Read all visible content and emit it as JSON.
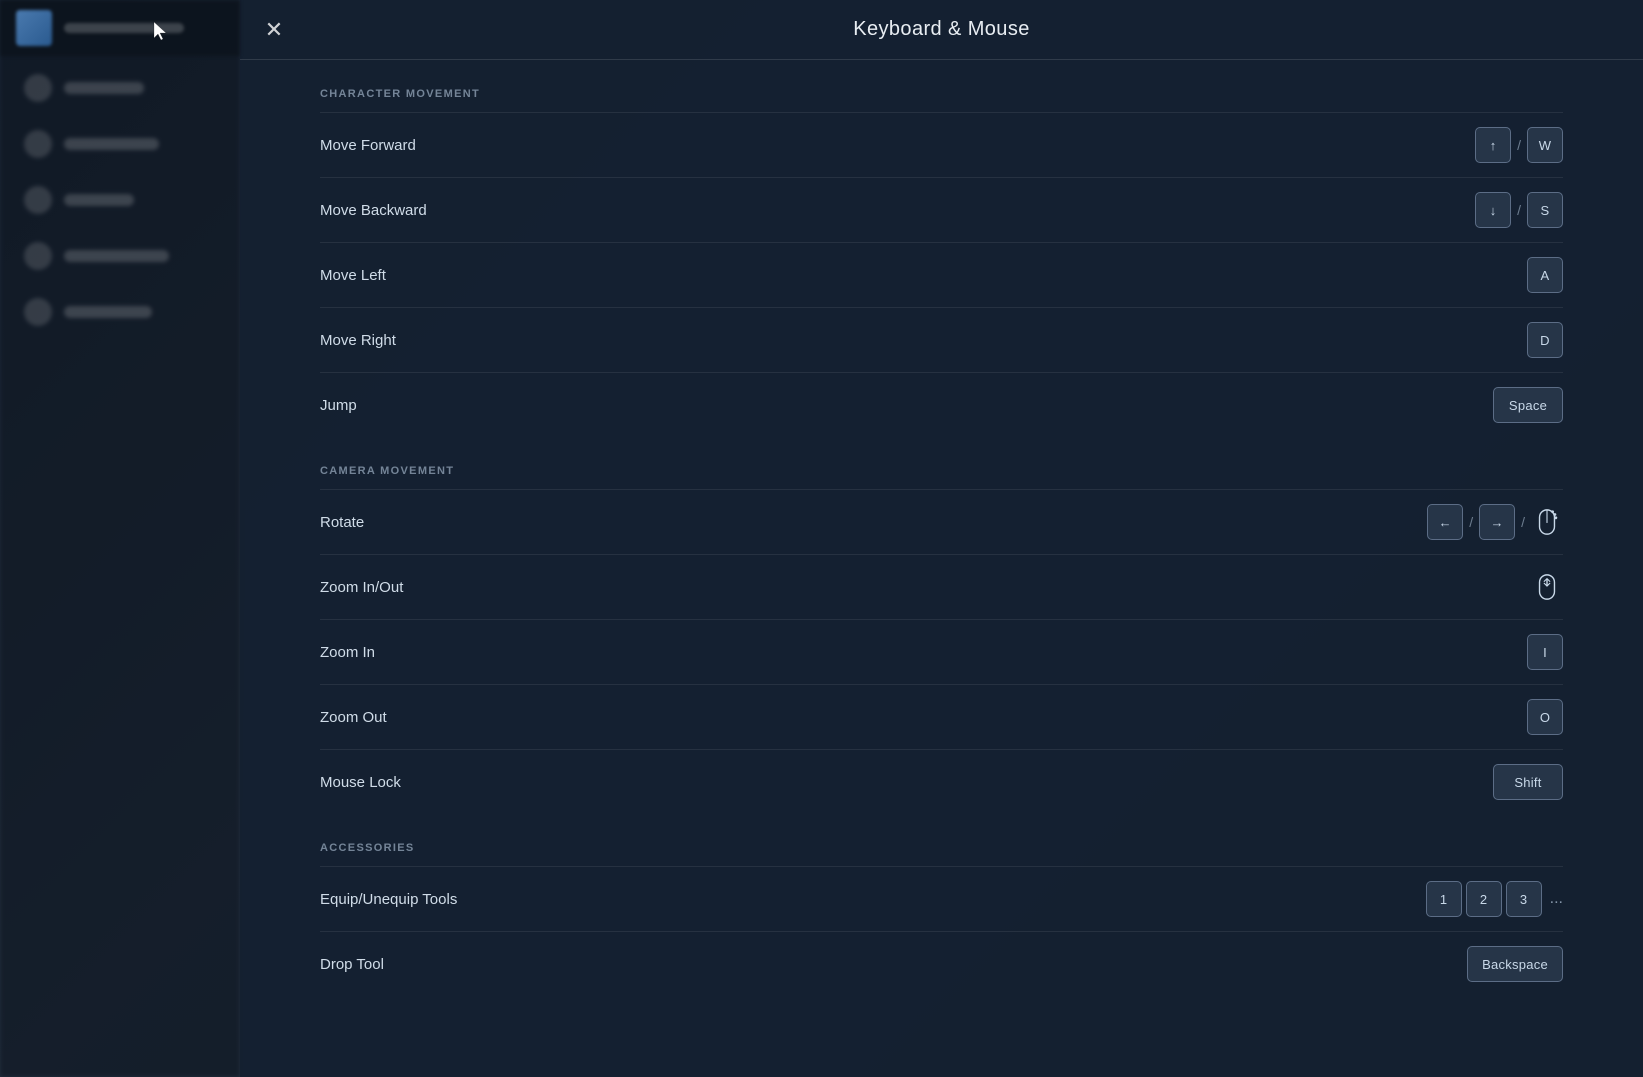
{
  "header": {
    "title": "Keyboard & Mouse",
    "close_label": "✕"
  },
  "sections": [
    {
      "id": "character-movement",
      "label": "CHARACTER MOVEMENT",
      "bindings": [
        {
          "id": "move-forward",
          "label": "Move Forward",
          "keys": [
            {
              "type": "key",
              "value": "↑"
            },
            {
              "type": "sep",
              "value": "/"
            },
            {
              "type": "key",
              "value": "W"
            }
          ]
        },
        {
          "id": "move-backward",
          "label": "Move Backward",
          "keys": [
            {
              "type": "key",
              "value": "↓"
            },
            {
              "type": "sep",
              "value": "/"
            },
            {
              "type": "key",
              "value": "S"
            }
          ]
        },
        {
          "id": "move-left",
          "label": "Move Left",
          "keys": [
            {
              "type": "key",
              "value": "A"
            }
          ]
        },
        {
          "id": "move-right",
          "label": "Move Right",
          "keys": [
            {
              "type": "key",
              "value": "D"
            }
          ]
        },
        {
          "id": "jump",
          "label": "Jump",
          "keys": [
            {
              "type": "key-wide",
              "value": "Space"
            }
          ]
        }
      ]
    },
    {
      "id": "camera-movement",
      "label": "CAMERA MOVEMENT",
      "bindings": [
        {
          "id": "rotate",
          "label": "Rotate",
          "keys": [
            {
              "type": "key",
              "value": "←"
            },
            {
              "type": "sep",
              "value": "/"
            },
            {
              "type": "key",
              "value": "→"
            },
            {
              "type": "sep",
              "value": "/"
            },
            {
              "type": "mouse",
              "value": "mouse-drag"
            }
          ]
        },
        {
          "id": "zoom-inout",
          "label": "Zoom In/Out",
          "keys": [
            {
              "type": "mouse",
              "value": "mouse-scroll"
            }
          ]
        },
        {
          "id": "zoom-in",
          "label": "Zoom In",
          "keys": [
            {
              "type": "key",
              "value": "I"
            }
          ]
        },
        {
          "id": "zoom-out",
          "label": "Zoom Out",
          "keys": [
            {
              "type": "key",
              "value": "O"
            }
          ]
        },
        {
          "id": "mouse-lock",
          "label": "Mouse Lock",
          "keys": [
            {
              "type": "key-wide",
              "value": "Shift"
            }
          ]
        }
      ]
    },
    {
      "id": "accessories",
      "label": "ACCESSORIES",
      "bindings": [
        {
          "id": "equip-tools",
          "label": "Equip/Unequip Tools",
          "keys": [
            {
              "type": "key",
              "value": "1"
            },
            {
              "type": "key",
              "value": "2"
            },
            {
              "type": "key",
              "value": "3"
            },
            {
              "type": "ellipsis",
              "value": "..."
            }
          ]
        },
        {
          "id": "drop-tool",
          "label": "Drop Tool",
          "keys": [
            {
              "type": "key-wide",
              "value": "Backspace"
            }
          ]
        }
      ]
    }
  ]
}
